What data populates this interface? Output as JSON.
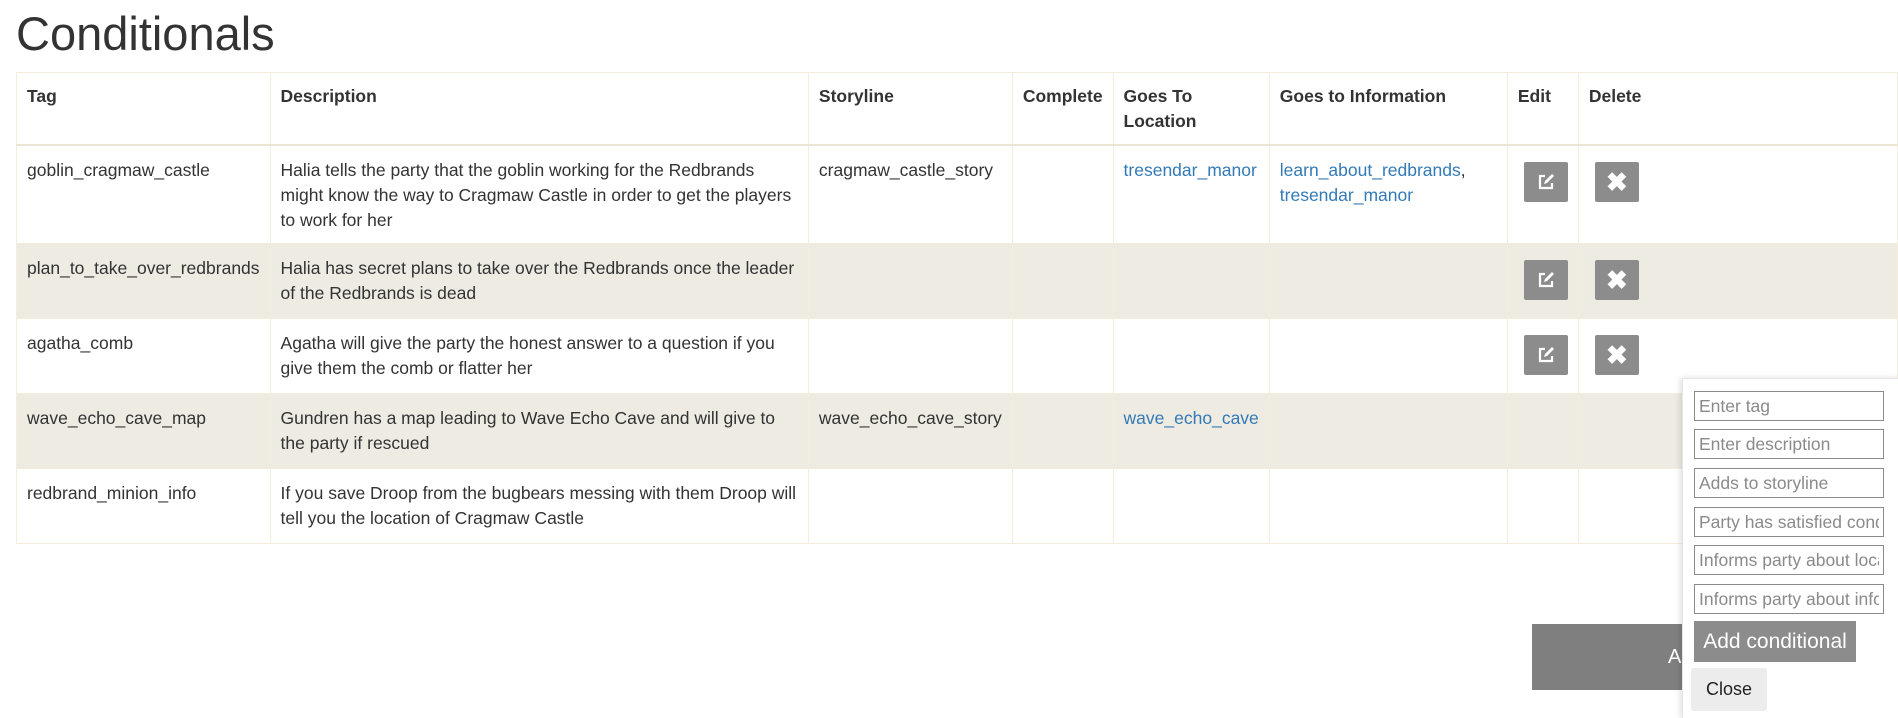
{
  "page": {
    "title": "Conditionals"
  },
  "table": {
    "headers": {
      "tag": "Tag",
      "description": "Description",
      "storyline": "Storyline",
      "complete": "Complete",
      "goes_to_location": "Goes To Location",
      "goes_to_information": "Goes to Information",
      "edit": "Edit",
      "delete": "Delete"
    },
    "rows": [
      {
        "tag": "goblin_cragmaw_castle",
        "description": "Halia tells the party that the goblin working for the Redbrands might know the way to Cragmaw Castle in order to get the players to work for her",
        "storyline": "cragmaw_castle_story",
        "complete": "",
        "location": "tresendar_manor",
        "info_1": "learn_about_redbrands",
        "info_sep": ",",
        "info_2": "tresendar_manor"
      },
      {
        "tag": "plan_to_take_over_redbrands",
        "description": "Halia has secret plans to take over the Redbrands once the leader of the Redbrands is dead",
        "storyline": "",
        "complete": "",
        "location": "",
        "info_1": "",
        "info_sep": "",
        "info_2": ""
      },
      {
        "tag": "agatha_comb",
        "description": "Agatha will give the party the honest answer to a question if you give them the comb or flatter her",
        "storyline": "",
        "complete": "",
        "location": "",
        "info_1": "",
        "info_sep": "",
        "info_2": ""
      },
      {
        "tag": "wave_echo_cave_map",
        "description": "Gundren has a map leading to Wave Echo Cave and will give to the party if rescued",
        "storyline": "wave_echo_cave_story",
        "complete": "",
        "location": "wave_echo_cave",
        "info_1": "",
        "info_sep": "",
        "info_2": ""
      },
      {
        "tag": "redbrand_minion_info",
        "description": "If you save Droop from the bugbears messing with them Droop will tell you the location of Cragmaw Castle",
        "storyline": "",
        "complete": "",
        "location": "",
        "info_1": "",
        "info_sep": "",
        "info_2": ""
      }
    ],
    "edit_icon": "edit-icon",
    "delete_icon": "close-icon",
    "delete_glyph": "✖"
  },
  "background_button": {
    "label": "A"
  },
  "add_panel": {
    "tag_placeholder": "Enter tag",
    "description_placeholder": "Enter description",
    "storyline_placeholder": "Adds to storyline",
    "satisfied_placeholder": "Party has satisfied cond",
    "location_placeholder": "Informs party about loca",
    "info_placeholder": "Informs party about info",
    "add_label": "Add conditional",
    "close_label": "Close"
  },
  "colors": {
    "link": "#337ab7",
    "button_gray": "#8c8c8c",
    "stripe": "#edebe2"
  }
}
